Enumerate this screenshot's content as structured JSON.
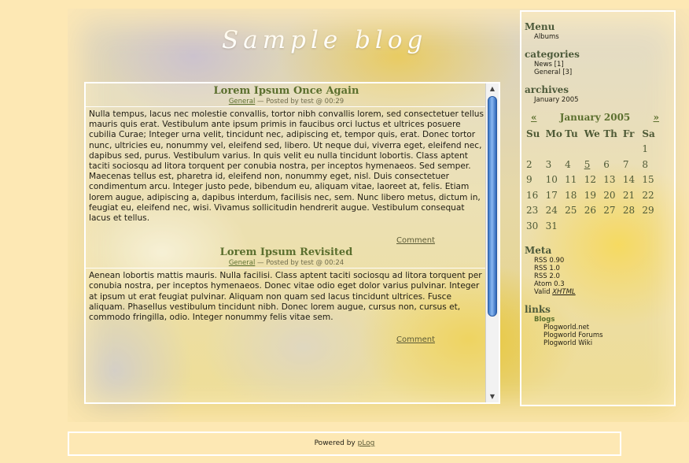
{
  "blog": {
    "title": "Sample blog"
  },
  "posts": [
    {
      "title": "Lorem Ipsum Once Again",
      "category": "General",
      "meta_rest": " — Posted by test @ 00:29",
      "body": "Nulla tempus, lacus nec molestie convallis, tortor nibh convallis lorem, sed consectetuer tellus mauris quis erat. Vestibulum ante ipsum primis in faucibus orci luctus et ultrices posuere cubilia Curae; Integer urna velit, tincidunt nec, adipiscing et, tempor quis, erat. Donec tortor nunc, ultricies eu, nonummy vel, eleifend sed, libero. Ut neque dui, viverra eget, eleifend nec, dapibus sed, purus. Vestibulum varius. In quis velit eu nulla tincidunt lobortis. Class aptent taciti sociosqu ad litora torquent per conubia nostra, per inceptos hymenaeos. Sed semper. Maecenas tellus est, pharetra id, eleifend non, nonummy eget, nisl. Duis consectetuer condimentum arcu. Integer justo pede, bibendum eu, aliquam vitae, laoreet at, felis. Etiam lorem augue, adipiscing a, dapibus interdum, facilisis nec, sem. Nunc libero metus, dictum in, feugiat eu, eleifend nec, wisi. Vivamus sollicitudin hendrerit augue. Vestibulum consequat lacus et tellus.",
      "comment": "Comment"
    },
    {
      "title": "Lorem Ipsum Revisited",
      "category": "General",
      "meta_rest": " — Posted by test @ 00:24",
      "body": "Aenean lobortis mattis mauris. Nulla facilisi. Class aptent taciti sociosqu ad litora torquent per conubia nostra, per inceptos hymenaeos. Donec vitae odio eget dolor varius pulvinar. Integer at ipsum ut erat feugiat pulvinar. Aliquam non quam sed lacus tincidunt ultrices. Fusce aliquam. Phasellus vestibulum tincidunt nibh. Donec lorem augue, cursus non, cursus et, commodo fringilla, odio. Integer nonummy felis vitae sem.",
      "comment": "Comment"
    }
  ],
  "sidebar": {
    "menu": {
      "heading": "Menu",
      "items": [
        "Albums"
      ]
    },
    "categories": {
      "heading": "categories",
      "items": [
        "News [1]",
        "General [3]"
      ]
    },
    "archives": {
      "heading": "archives",
      "items": [
        "January 2005"
      ]
    },
    "calendar": {
      "prev": "«",
      "month": "January 2005",
      "next": "»",
      "weekdays": [
        "Su",
        "Mo",
        "Tu",
        "We",
        "Th",
        "Fr",
        "Sa"
      ],
      "weeks": [
        [
          "",
          "",
          "",
          "",
          "",
          "",
          "1"
        ],
        [
          "2",
          "3",
          "4",
          "5",
          "6",
          "7",
          "8"
        ],
        [
          "9",
          "10",
          "11",
          "12",
          "13",
          "14",
          "15"
        ],
        [
          "16",
          "17",
          "18",
          "19",
          "20",
          "21",
          "22"
        ],
        [
          "23",
          "24",
          "25",
          "26",
          "27",
          "28",
          "29"
        ],
        [
          "30",
          "31",
          "",
          "",
          "",
          "",
          ""
        ]
      ]
    },
    "meta": {
      "heading": "Meta",
      "items": [
        "RSS 0.90",
        "RSS 1.0",
        "RSS 2.0",
        "Atom 0.3"
      ],
      "valid_prefix": "Valid ",
      "valid_link": "XHTML"
    },
    "links": {
      "heading": "links",
      "group": "Blogs",
      "items": [
        "Plogworld.net",
        "Plogworld Forums",
        "Plogworld Wiki"
      ]
    }
  },
  "footer": {
    "prefix": "Powered by ",
    "link": "pLog"
  }
}
